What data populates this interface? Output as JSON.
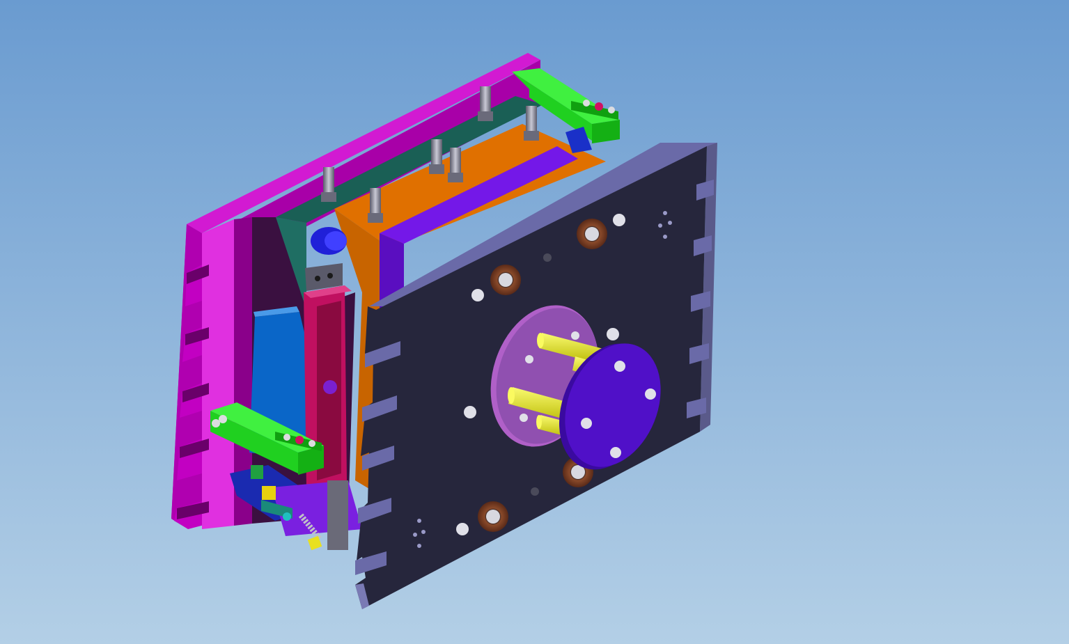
{
  "app": {
    "view": "3d-model-viewport"
  },
  "model": {
    "assembly": "injection-mold-assembly",
    "parts": [
      "clamp-plate-rear",
      "support-plate",
      "cavity-plate",
      "core-plate",
      "clamp-plate-front",
      "sprue-bushing-disc",
      "locating-ring",
      "guide-pins",
      "water-fittings",
      "latch-arm-top",
      "latch-arm-bottom",
      "slide-block",
      "spring-latch"
    ]
  },
  "colors": {
    "background_top": "#6a9bd0",
    "background_bottom": "#b3cfe6",
    "rear_plate": "#c200c2",
    "rear_plate_side": "#8e008e",
    "support_plate": "#1f6e63",
    "cavity_plate": "#e07000",
    "core_plate": "#6a10d8",
    "front_plate": "#2a2a40",
    "front_plate_edge": "#6a6aa8",
    "disc": "#c070d8",
    "locating_ring": "#5010c8",
    "pins": "#e8e820",
    "latch": "#20e020",
    "slide": "#0a66c8",
    "slide_block": "#c01060",
    "fittings": "#8a8a9a"
  }
}
